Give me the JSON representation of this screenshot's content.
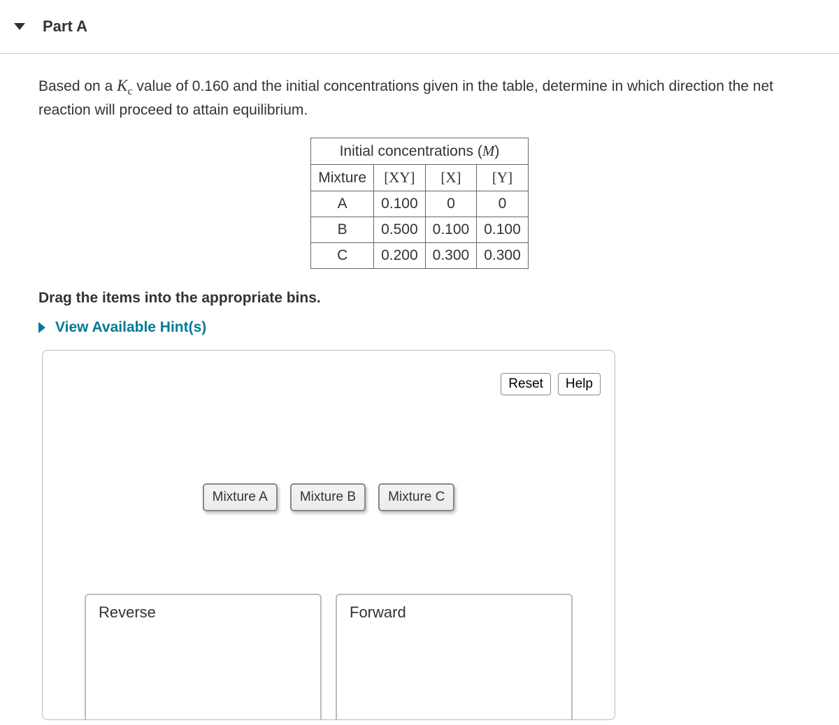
{
  "part": {
    "title": "Part A"
  },
  "prompt": {
    "prefix": "Based on a ",
    "kc_symbol": "K",
    "kc_sub": "c",
    "middle": " value of  0.160 and the initial concentrations given in the table, determine in which direction the net reaction will proceed to attain equilibrium."
  },
  "table": {
    "title_prefix": "Initial concentrations (",
    "title_unit": "M",
    "title_suffix": ")",
    "headers": {
      "mixture": "Mixture",
      "xy": "[XY]",
      "x": "[X]",
      "y": "[Y]"
    },
    "rows": [
      {
        "label": "A",
        "xy": "0.100",
        "x": "0",
        "y": "0"
      },
      {
        "label": "B",
        "xy": "0.500",
        "x": "0.100",
        "y": "0.100"
      },
      {
        "label": "C",
        "xy": "0.200",
        "x": "0.300",
        "y": "0.300"
      }
    ]
  },
  "instruction": "Drag the items into the appropriate bins.",
  "hints_label": "View Available Hint(s)",
  "buttons": {
    "reset": "Reset",
    "help": "Help"
  },
  "chips": [
    "Mixture A",
    "Mixture B",
    "Mixture C"
  ],
  "bins": [
    "Reverse",
    "Forward"
  ]
}
